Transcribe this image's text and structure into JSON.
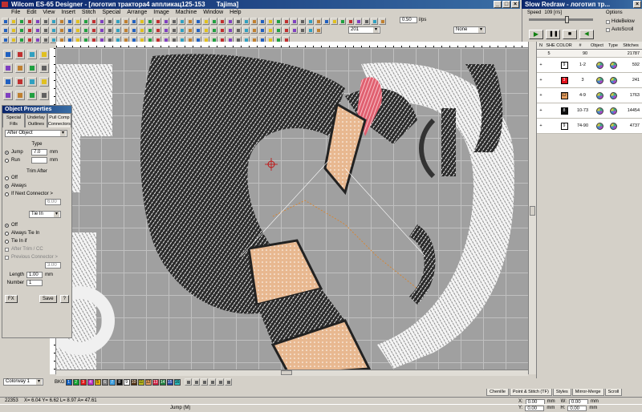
{
  "window": {
    "title": "Wilcom ES-65 Designer - [логотип трактора4 аппликац125-153",
    "title_extra": "Tajima]"
  },
  "menu": [
    "File",
    "Edit",
    "View",
    "Insert",
    "Stitch",
    "Special",
    "Arrange",
    "Image",
    "Machine",
    "Window",
    "Help"
  ],
  "toolbar": {
    "zoom_value": "0.50",
    "zoom_unit": "l/ps",
    "counter_value": "201",
    "color_select": "None"
  },
  "slow_redraw": {
    "title": "Slow Redraw - логотип тр...",
    "speed_label": "Speed",
    "speed_value": "109 [r/s]",
    "options_label": "Options",
    "hide_below": "HideBelow",
    "auto_scroll": "AutoScroll"
  },
  "object_properties": {
    "title": "Object Properties",
    "tabs": [
      "Special Fills",
      "Underlay Outlines",
      "Pull Comp Connectors"
    ],
    "after_object": "After Object",
    "type_label": "Type",
    "jump_label": "Jump",
    "jump_value": "7.0",
    "jump_unit": "mm",
    "run_label": "Run",
    "run_unit": "mm",
    "trim_after_label": "Trim After",
    "trim_off": "Off",
    "trim_always": "Always",
    "trim_if_next": "If Next Connector >",
    "trim_value": "6.00",
    "tie_in_select": "Tie In",
    "tie_off": "Off",
    "tie_always": "Always Tie In",
    "tie_in_if": "Tie In if",
    "after_trim": "After Trim / CC",
    "prev_connector": "Previous Connector >",
    "tie_value": "3.00",
    "length_label": "Length",
    "length_value": "1.00",
    "length_unit": "mm",
    "number_label": "Number",
    "number_value": "1",
    "fx_button": "FX",
    "save_button": "Save",
    "help_button": "?"
  },
  "object_list": {
    "headers": [
      "N",
      "SHE",
      "COLOR",
      "#",
      "Object",
      "Type",
      "Stitches"
    ],
    "top": {
      "n": "5",
      "range": "90",
      "stitches": "21787"
    },
    "rows": [
      {
        "color_no": "9",
        "color": "#ffffff",
        "text_color": "#000000",
        "range": "1-2",
        "stitches": "592"
      },
      {
        "color_no": "3",
        "color": "#e0101a",
        "text_color": "#ffffff",
        "range": "3",
        "stitches": "241"
      },
      {
        "color_no": "12",
        "color": "#e8a060",
        "text_color": "#000000",
        "range": "4-9",
        "stitches": "1763"
      },
      {
        "color_no": "8",
        "color": "#101010",
        "text_color": "#ffffff",
        "range": "10-73",
        "stitches": "14454"
      },
      {
        "color_no": "9",
        "color": "#ffffff",
        "text_color": "#000000",
        "range": "74-90",
        "stitches": "4737"
      }
    ]
  },
  "colorbar": {
    "colorway": "Colorway 1",
    "bkg": "BKG",
    "swatches": [
      {
        "n": "1",
        "c": "#1060c0"
      },
      {
        "n": "2",
        "c": "#10a030"
      },
      {
        "n": "3",
        "c": "#e01818"
      },
      {
        "n": "4",
        "c": "#c030c0"
      },
      {
        "n": "5",
        "c": "#e0b010"
      },
      {
        "n": "6",
        "c": "#808080"
      },
      {
        "n": "7",
        "c": "#40a0e0"
      },
      {
        "n": "8",
        "c": "#101010"
      },
      {
        "n": "9",
        "c": "#ffffff"
      },
      {
        "n": "10",
        "c": "#503010"
      },
      {
        "n": "11",
        "c": "#c0c020"
      },
      {
        "n": "12",
        "c": "#e8a060"
      },
      {
        "n": "13",
        "c": "#d02040"
      },
      {
        "n": "14",
        "c": "#208040"
      },
      {
        "n": "15",
        "c": "#2040a0"
      },
      {
        "n": "16",
        "c": "#30c0c0"
      }
    ]
  },
  "bottom_tabs": [
    "Chenille",
    "Point & Stitch (TF)",
    "Styles",
    "Mirror-Merge",
    "Scroll"
  ],
  "status": {
    "stitches": "22353",
    "coords": "X= 6.04 Y= 6.62 L= 8.97 A= 47.61",
    "mode": "Jump (M)",
    "x_label": "X:",
    "x_value": "0.00",
    "y_label": "Y:",
    "y_value": "0.00",
    "w_label": "W:",
    "w_value": "0.00",
    "h_label": "H:",
    "h_value": "0.00",
    "unit": "mm"
  },
  "colors": {
    "accent": "#0a246a",
    "canvas": "#a0a0a0"
  }
}
